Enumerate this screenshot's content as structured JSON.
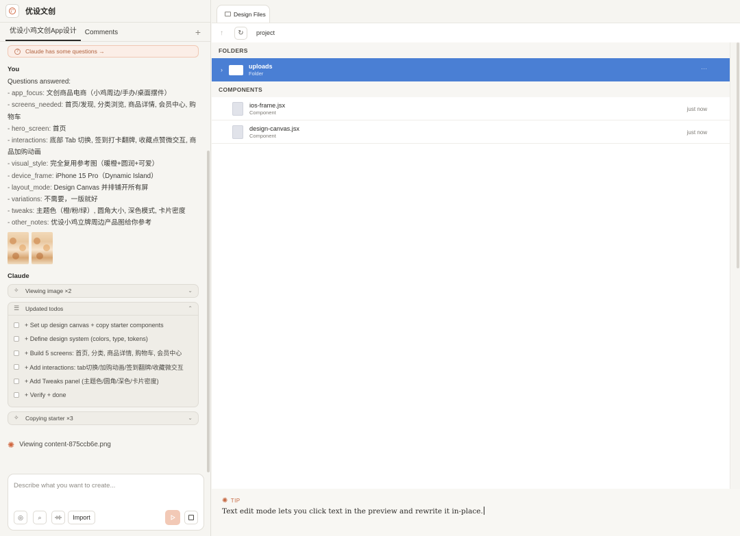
{
  "app": {
    "title": "优设文创"
  },
  "chat_tabs": [
    {
      "label": "优设小鸡文创App设计",
      "active": true
    },
    {
      "label": "Comments",
      "active": false
    }
  ],
  "chat": {
    "questions_pill": "Claude has some questions →",
    "user_label": "You",
    "user_lines": [
      {
        "key": "",
        "text": "Questions answered:"
      },
      {
        "key": "- app_focus: ",
        "text": "文创商品电商（小鸡周边/手办/桌面摆件）"
      },
      {
        "key": "- screens_needed: ",
        "text": "首页/发现, 分类浏览, 商品详情, 会员中心, 购"
      },
      {
        "key": "",
        "text": "物车"
      },
      {
        "key": "- hero_screen: ",
        "text": "首页"
      },
      {
        "key": "- interactions: ",
        "text": "底部 Tab 切换, 签到打卡翻牌, 收藏点赞微交互, 商"
      },
      {
        "key": "",
        "text": "品加购动画"
      },
      {
        "key": "- visual_style: ",
        "text": "完全复用参考图（暖橙+圆润+可爱）"
      },
      {
        "key": "- device_frame: ",
        "text": "iPhone 15 Pro（Dynamic Island）"
      },
      {
        "key": "- layout_mode: ",
        "text": "Design Canvas 并排铺开所有屏"
      },
      {
        "key": "- variations: ",
        "text": "不需要，一版就好"
      },
      {
        "key": "- tweaks: ",
        "text": "主题色（橙/粉/绿）, 圆角大小, 深色模式, 卡片密度"
      },
      {
        "key": "- other_notes: ",
        "text": "优设小鸡立牌周边产品图给你参考"
      }
    ],
    "claude_label": "Claude",
    "tool_viewing": "Viewing image ×2",
    "tool_todos": "Updated todos",
    "todos": [
      "+ Set up design canvas + copy starter components",
      "+ Define design system (colors, type, tokens)",
      "+ Build 5 screens: 首页, 分类, 商品详情, 购物车, 会员中心",
      "+ Add interactions: tab切换/加购动画/签到翻牌/收藏微交互",
      "+ Add Tweaks panel (主题色/圆角/深色/卡片密度)",
      "+ Verify + done"
    ],
    "tool_copying": "Copying starter ×3",
    "viewing_status": "Viewing content-875ccb6e.png"
  },
  "composer": {
    "placeholder": "Describe what you want to create...",
    "import_label": "Import"
  },
  "files": {
    "tab_label": "Design Files",
    "path": "project",
    "folders_header": "FOLDERS",
    "folders": [
      {
        "name": "uploads",
        "kind": "Folder",
        "more": "···"
      }
    ],
    "components_header": "COMPONENTS",
    "components": [
      {
        "name": "ios-frame.jsx",
        "kind": "Component",
        "time": "just now"
      },
      {
        "name": "design-canvas.jsx",
        "kind": "Component",
        "time": "just now"
      }
    ]
  },
  "tip": {
    "label": "TIP",
    "text": "Text edit mode lets you click text in the preview and rewrite it in-place."
  },
  "colors": {
    "accent_orange": "#c66a44",
    "selection_blue": "#4a7fd4",
    "send_button": "#f2c9b6"
  },
  "icons": {
    "app_logo": "palette-icon",
    "question": "question-circle-icon",
    "viewing": "sparkle-icon",
    "todos": "checklist-icon",
    "burst": "claude-burst-icon"
  }
}
